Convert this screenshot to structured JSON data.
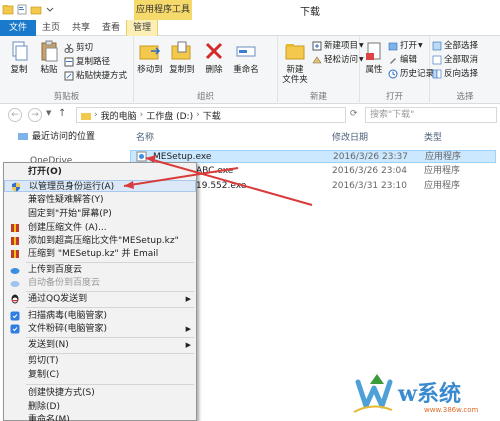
{
  "window": {
    "title": "下载",
    "context_tab_group": "应用程序工具"
  },
  "tabs": [
    {
      "label": "文件"
    },
    {
      "label": "主页"
    },
    {
      "label": "共享"
    },
    {
      "label": "查看"
    },
    {
      "label": "管理"
    }
  ],
  "ribbon": {
    "clipboard": {
      "label": "剪贴板",
      "copy": "复制",
      "paste": "粘贴",
      "cut": "剪切",
      "copy_path": "复制路径",
      "paste_shortcut": "粘贴快捷方式"
    },
    "organize": {
      "label": "组织",
      "move_to": "移动到",
      "copy_to": "复制到",
      "delete": "删除",
      "rename": "重命名"
    },
    "new": {
      "label": "新建",
      "new_folder": "新建\n文件夹",
      "new_item": "新建项目",
      "easy_access": "轻松访问"
    },
    "open": {
      "label": "打开",
      "properties": "属性",
      "open": "打开",
      "edit": "编辑",
      "history": "历史记录"
    },
    "select": {
      "label": "选择",
      "select_all": "全部选择",
      "select_none": "全部取消",
      "invert": "反向选择"
    }
  },
  "address": {
    "crumbs": [
      "我的电脑",
      "工作盘 (D:)",
      "下载"
    ],
    "search_placeholder": "搜索\"下载\""
  },
  "sidebar": {
    "recent": "最近访问的位置",
    "onedrive": "OneDrive"
  },
  "columns": {
    "name": "名称",
    "modified": "修改日期",
    "type": "类型"
  },
  "files": [
    {
      "name": "MESetup.exe",
      "modified": "2016/3/26 23:37",
      "type": "应用程序",
      "selected": true
    },
    {
      "name": "ABC.exe",
      "modified": "2016/3/26 23:04",
      "type": "应用程序",
      "selected": false
    },
    {
      "name": "19.552.exe",
      "modified": "2016/3/31 23:10",
      "type": "应用程序",
      "selected": false
    }
  ],
  "context_menu": [
    {
      "label": "打开(O)",
      "bold": true,
      "icon": ""
    },
    {
      "label": "以管理员身份运行(A)",
      "highlight": true,
      "icon": "shield-icon"
    },
    {
      "label": "兼容性疑难解答(Y)",
      "icon": ""
    },
    {
      "label": "固定到\"开始\"屏幕(P)",
      "icon": ""
    },
    {
      "label": "创建压缩文件 (A)...",
      "icon": "archive-icon"
    },
    {
      "label": "添加到超高压缩比文件\"MESetup.kz\"",
      "icon": "archive-icon"
    },
    {
      "label": "压缩到 \"MESetup.kz\" 并 Email",
      "icon": "archive-icon"
    },
    {
      "label": "上传到百度云",
      "icon": "cloud-icon"
    },
    {
      "label": "自动备份到百度云",
      "icon": "cloud-icon",
      "disabled": true
    },
    {
      "label": "通过QQ发送到",
      "icon": "qq-icon",
      "submenu": true
    },
    {
      "label": "扫描病毒(电脑管家)",
      "icon": "shield-blue-icon"
    },
    {
      "label": "文件粉碎(电脑管家)",
      "icon": "shield-blue-icon",
      "submenu": true
    },
    {
      "label": "发送到(N)",
      "icon": "",
      "submenu": true
    },
    {
      "label": "剪切(T)",
      "icon": ""
    },
    {
      "label": "复制(C)",
      "icon": ""
    },
    {
      "label": "创建快捷方式(S)",
      "icon": ""
    },
    {
      "label": "删除(D)",
      "icon": ""
    },
    {
      "label": "重命名(M)",
      "icon": ""
    }
  ],
  "watermark": {
    "text": "w系统",
    "url": "www.386w.com"
  },
  "colors": {
    "accent": "#1979ca",
    "selection": "#cce8ff",
    "context_tab": "#f5d96b",
    "arrow": "#d93a3a"
  }
}
